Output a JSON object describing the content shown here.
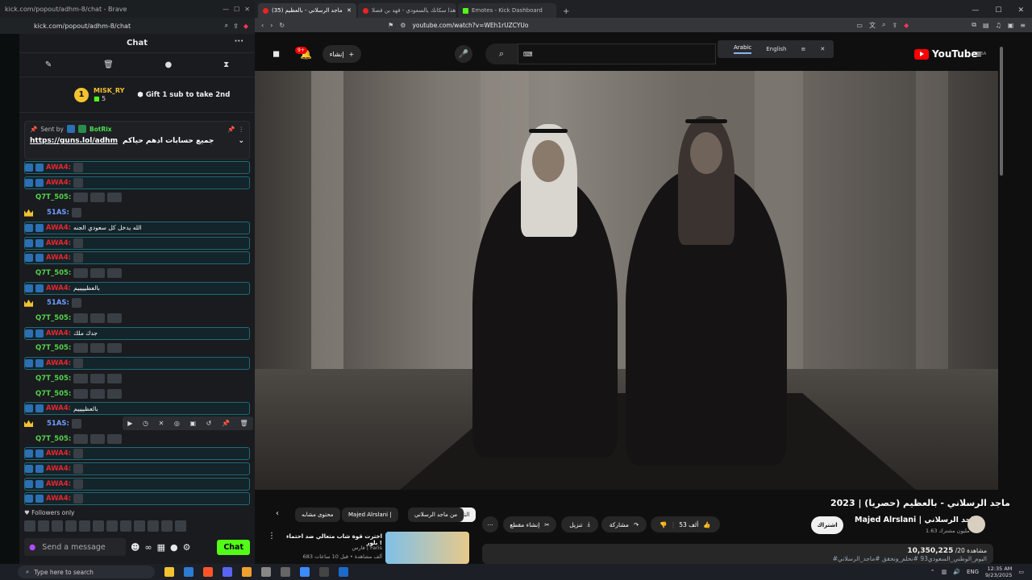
{
  "left_window": {
    "title": "kick.com/popout/adhm-8/chat - Brave",
    "url": "kick.com/popout/adhm-8/chat"
  },
  "chat": {
    "title": "Chat",
    "more": "···",
    "tools": [
      "pin-icon",
      "delete-icon",
      "chat-bubble-icon",
      "hourglass-icon"
    ],
    "leader": {
      "rank": "1",
      "name": "MISK_RY",
      "count": "5",
      "gift_text": "Gift 1 sub to take 2nd"
    },
    "pinned": {
      "sent_by": "Sent by",
      "bot": "BotRix",
      "link": "https://guns.lol/adhm",
      "text": "جميع حسابات ادهم حياكم"
    },
    "messages": [
      {
        "user": "AWA4:",
        "color": "red",
        "hl": true,
        "text": ""
      },
      {
        "user": "AWA4:",
        "color": "red",
        "hl": true,
        "text": ""
      },
      {
        "user": "Q7T_505:",
        "color": "green",
        "hl": false,
        "text": ""
      },
      {
        "user": "51AS:",
        "color": "blue",
        "hl": false,
        "text": ""
      },
      {
        "user": "AWA4:",
        "color": "red",
        "hl": true,
        "text": "الله يدخل كل سعودي الجنه"
      },
      {
        "user": "AWA4:",
        "color": "red",
        "hl": true,
        "text": ""
      },
      {
        "user": "AWA4:",
        "color": "red",
        "hl": true,
        "text": ""
      },
      {
        "user": "Q7T_505:",
        "color": "green",
        "hl": false,
        "text": ""
      },
      {
        "user": "AWA4:",
        "color": "red",
        "hl": true,
        "text": "بالعظيييييم"
      },
      {
        "user": "51AS:",
        "color": "blue",
        "hl": false,
        "text": ""
      },
      {
        "user": "Q7T_505:",
        "color": "green",
        "hl": false,
        "text": ""
      },
      {
        "user": "AWA4:",
        "color": "red",
        "hl": true,
        "text": "جدك ملك"
      },
      {
        "user": "Q7T_505:",
        "color": "green",
        "hl": false,
        "text": ""
      },
      {
        "user": "AWA4:",
        "color": "red",
        "hl": true,
        "text": ""
      },
      {
        "user": "Q7T_505:",
        "color": "green",
        "hl": false,
        "text": ""
      },
      {
        "user": "Q7T_505:",
        "color": "green",
        "hl": false,
        "text": ""
      },
      {
        "user": "AWA4:",
        "color": "red",
        "hl": true,
        "text": "بالعظييييم"
      },
      {
        "user": "51AS:",
        "color": "blue",
        "hl": false,
        "text": ""
      },
      {
        "user": "Q7T_505:",
        "color": "green",
        "hl": false,
        "text": ""
      },
      {
        "user": "AWA4:",
        "color": "red",
        "hl": true,
        "text": ""
      },
      {
        "user": "AWA4:",
        "color": "red",
        "hl": true,
        "text": ""
      },
      {
        "user": "AWA4:",
        "color": "red",
        "hl": true,
        "text": ""
      },
      {
        "user": "AWA4:",
        "color": "red",
        "hl": true,
        "text": ""
      }
    ],
    "followers_only": "Followers only",
    "input_placeholder": "Send a message",
    "send_label": "Chat"
  },
  "browser": {
    "tabs": [
      {
        "label": "(35) ماجد الرسلاني - بالعظيم",
        "active": true,
        "icon": "yt"
      },
      {
        "label": "هذا سكانك يالسعودي - فهد بن فصلا",
        "active": false,
        "icon": "yt"
      },
      {
        "label": "Emotes - Kick Dashboard",
        "active": false,
        "icon": "kick"
      }
    ],
    "url": "youtube.com/watch?v=WEh1rUZCYUo"
  },
  "youtube": {
    "create_label": "إنشاء",
    "notif_count": "9+",
    "translate": {
      "option1": "Arabic",
      "option2": "English"
    },
    "logo": "YouTube",
    "region": "SA",
    "video_title": "ماجد الرسلاني - بالعظيم (حصريا) | 2023",
    "channel_name": "Majed Alrslani | ماجد الرسلاني",
    "channel_subs": "1.63 مليون مشترك",
    "subscribe": "اشتراك",
    "likes": "53 ألف",
    "share": "مشاركة",
    "download": "تنزيل",
    "clip": "إنشاء مقطع",
    "chips": [
      "التالي",
      "من ماجد الرسلاني",
      "Majed Alrslani |",
      "محتوى مشابه"
    ],
    "views": "10,350,225",
    "views_suffix": "مشاهدة 20/",
    "hashtags": "#اليوم_الوطني_السعودي93 #نحلم_ونحقق #ماجد_الرسلاني",
    "rec_title": "اخترت قوة شاب متعالي ضد احتماء بلور !",
    "rec_channel": "فارس | Faris",
    "rec_meta": "683 ألف مشاهدة • قبل 10 ساعات"
  },
  "taskbar": {
    "search": "Type here to search",
    "lang": "ENG",
    "time": "12:35 AM",
    "date": "9/23/2025"
  }
}
